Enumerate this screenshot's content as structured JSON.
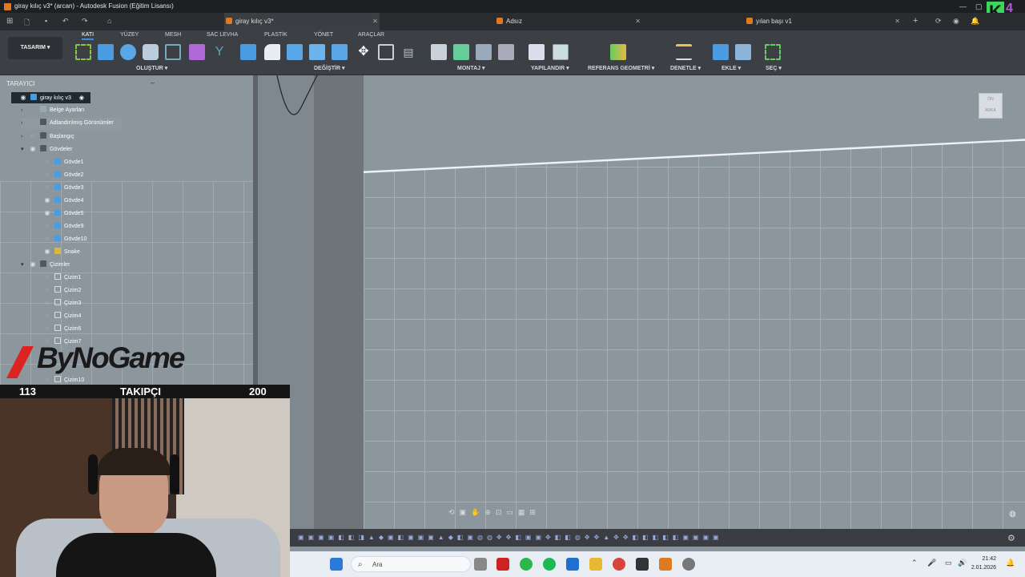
{
  "window": {
    "title": "giray kılıç v3* (arcan) - Autodesk Fusion (Eğitim Lisansı)",
    "badge_letter": "K",
    "badge_number": "4"
  },
  "tabs": [
    {
      "label": "giray kılıç v3*",
      "active": true
    },
    {
      "label": "Adsız",
      "active": false
    },
    {
      "label": "yılan başı v1",
      "active": false
    }
  ],
  "ribbon": {
    "workspace": "TASARIM",
    "tabs": [
      "KATI",
      "YÜZEY",
      "MESH",
      "SAC LEVHA",
      "PLASTİK",
      "YÖNET",
      "ARAÇLAR"
    ],
    "groups": [
      "OLUŞTUR",
      "DEĞİŞTİR",
      "MONTAJ",
      "YAPILANDIR",
      "REFERANS GEOMETRİ",
      "DENETLE",
      "EKLE",
      "SEÇ"
    ]
  },
  "browser": {
    "header": "TARAYICI",
    "root": "giray kılıç v3",
    "nodes": [
      "Belge Ayarları",
      "Adlandırılmış Görünümler",
      "Başlangıç",
      "Gövdeler",
      "Gövde1",
      "Gövde2",
      "Gövde3",
      "Gövde4",
      "Gövde5",
      "Gövde9",
      "Gövde10",
      "Snake",
      "Çizimler",
      "Çizim1",
      "Çizim2",
      "Çizim3",
      "Çizim4",
      "Çizim6",
      "Çizim7",
      "Çizim10"
    ]
  },
  "overlay": {
    "brand": "ByNoGame",
    "followers_current": "113",
    "followers_label": "TAKIPÇI",
    "followers_goal": "200"
  },
  "taskbar": {
    "search_placeholder": "Ara",
    "time": "21:42",
    "date": "2.01.2026"
  },
  "viewcube": {
    "front": "ÖN",
    "back": "ARKA"
  },
  "colors": {
    "accent": "#3a8fd6",
    "brand_orange": "#e07a1f",
    "viewport": "#8c969d"
  }
}
